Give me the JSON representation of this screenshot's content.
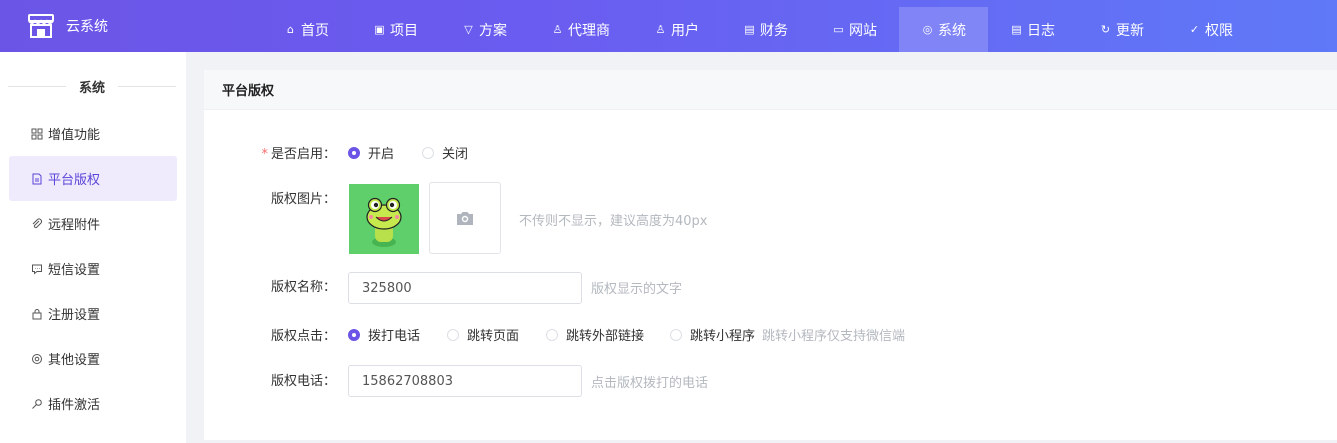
{
  "app": {
    "name": "云系统"
  },
  "nav": [
    {
      "label": "首页",
      "icon": "home-icon"
    },
    {
      "label": "项目",
      "icon": "briefcase-icon"
    },
    {
      "label": "方案",
      "icon": "diamond-icon"
    },
    {
      "label": "代理商",
      "icon": "users-icon"
    },
    {
      "label": "用户",
      "icon": "user-icon"
    },
    {
      "label": "财务",
      "icon": "finance-icon"
    },
    {
      "label": "网站",
      "icon": "website-icon"
    },
    {
      "label": "系统",
      "icon": "system-icon",
      "active": true
    },
    {
      "label": "日志",
      "icon": "log-icon"
    },
    {
      "label": "更新",
      "icon": "refresh-icon"
    },
    {
      "label": "权限",
      "icon": "shield-check-icon"
    }
  ],
  "sidebar": {
    "title": "系统",
    "items": [
      {
        "label": "增值功能",
        "icon": "grid-icon"
      },
      {
        "label": "平台版权",
        "icon": "document-icon",
        "active": true
      },
      {
        "label": "远程附件",
        "icon": "paperclip-icon"
      },
      {
        "label": "短信设置",
        "icon": "message-icon"
      },
      {
        "label": "注册设置",
        "icon": "lock-icon"
      },
      {
        "label": "其他设置",
        "icon": "settings-icon"
      },
      {
        "label": "插件激活",
        "icon": "key-icon"
      }
    ]
  },
  "panel": {
    "title": "平台版权"
  },
  "form": {
    "enabled": {
      "label": "是否启用：",
      "required_mark": "*",
      "options": [
        "开启",
        "关闭"
      ],
      "selected": "开启"
    },
    "image": {
      "label": "版权图片：",
      "hint": "不传则不显示，建议高度为40px"
    },
    "name": {
      "label": "版权名称：",
      "value": "325800",
      "hint": "版权显示的文字"
    },
    "click": {
      "label": "版权点击：",
      "options": [
        "拨打电话",
        "跳转页面",
        "跳转外部链接",
        "跳转小程序"
      ],
      "selected": "拨打电话",
      "hint": "跳转小程序仅支持微信端"
    },
    "phone": {
      "label": "版权电话：",
      "value": "15862708803",
      "hint": "点击版权拨打的电话"
    }
  },
  "colors": {
    "accent": "#6a55e6",
    "header_start": "#6b55e6",
    "header_end": "#5f79f8",
    "thumb_bg": "#5fcf6b"
  }
}
